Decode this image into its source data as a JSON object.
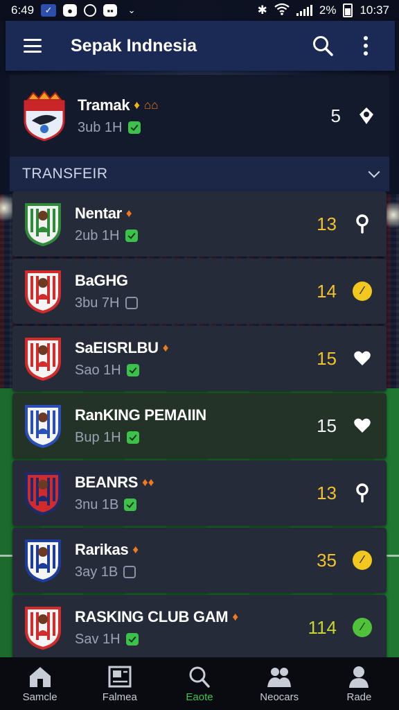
{
  "status_bar": {
    "time": "6:49",
    "battery": "2%",
    "clock": "10:37"
  },
  "app_bar": {
    "title": "Sepak Indnesia"
  },
  "featured": {
    "name": "Tramak",
    "sub": "3ub 1H",
    "score": "5"
  },
  "section": {
    "title": "TRANSFEIR"
  },
  "rows": [
    {
      "name": "Nentar",
      "sub": "2ub 1H",
      "score": "13",
      "score_color": "#f2c12e",
      "badges": "♦",
      "check": "on",
      "icon": "pin-icon"
    },
    {
      "name": "BaGHG",
      "sub": "3bu 7H",
      "score": "14",
      "score_color": "#f2c12e",
      "badges": "",
      "check": "off",
      "icon": "yellow-circle-icon"
    },
    {
      "name": "SaEISRLBU",
      "sub": "Sao 1H",
      "score": "15",
      "score_color": "#f2c12e",
      "badges": "♦",
      "check": "on",
      "icon": "heart-icon"
    },
    {
      "name": "RanKING PEMAIIN",
      "sub": "Bup 1H",
      "score": "15",
      "score_color": "#f3f4f8",
      "badges": "",
      "check": "on",
      "icon": "heart-icon"
    },
    {
      "name": "BEANRS",
      "sub": "3nu 1B",
      "score": "13",
      "score_color": "#f2c12e",
      "badges": "♦♦",
      "check": "on",
      "icon": "pin-icon"
    },
    {
      "name": "Rarikas",
      "sub": "3ay 1B",
      "score": "35",
      "score_color": "#f2c12e",
      "badges": "♦",
      "check": "off",
      "icon": "yellow-circle-icon"
    },
    {
      "name": "RASKING CLUB GAM",
      "sub": "Sav 1H",
      "score": "114",
      "score_color": "#c9d62e",
      "badges": "♦",
      "check": "on",
      "icon": "green-circle-icon"
    }
  ],
  "bottom_nav": [
    {
      "label": "Samcle",
      "icon": "home-icon"
    },
    {
      "label": "Falmea",
      "icon": "news-icon"
    },
    {
      "label": "Eaote",
      "icon": "search-icon"
    },
    {
      "label": "Neocars",
      "icon": "team-icon"
    },
    {
      "label": "Rade",
      "icon": "profile-icon"
    }
  ],
  "colors": {
    "accent": "#3fc44e",
    "score_gold": "#f2c12e",
    "appbar": "#1b2a55"
  }
}
